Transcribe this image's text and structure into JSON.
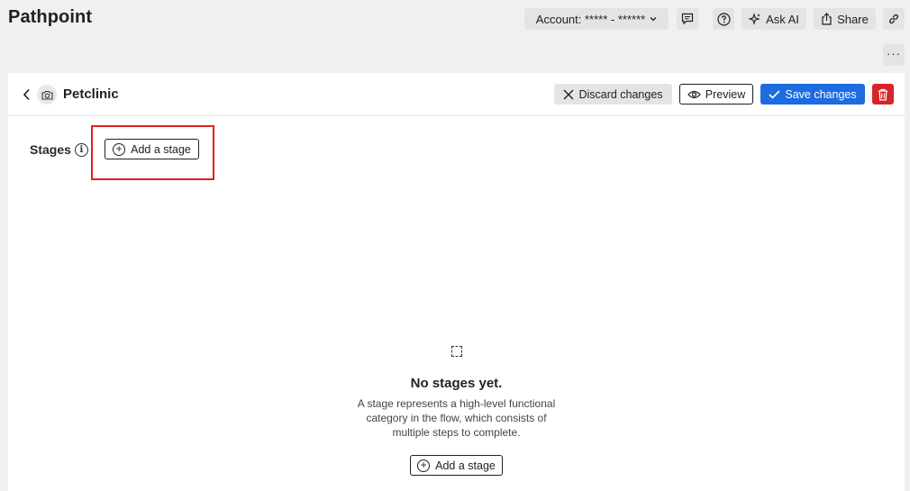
{
  "app": {
    "title": "Pathpoint"
  },
  "topbar": {
    "account_label": "Account: ***** - ******",
    "ask_ai": "Ask AI",
    "share": "Share",
    "more": "···"
  },
  "header": {
    "flow_title": "Petclinic",
    "discard": "Discard changes",
    "preview": "Preview",
    "save": "Save changes"
  },
  "stages": {
    "label": "Stages",
    "add_label": "Add a stage"
  },
  "empty_state": {
    "title": "No stages yet.",
    "description_lines": [
      "A stage represents a high-level functional",
      "category in the flow, which consists of",
      "multiple steps to complete."
    ],
    "add_label": "Add a stage"
  },
  "colors": {
    "primary": "#1d6ce0",
    "danger": "#d6242a",
    "highlight": "#e02020"
  }
}
